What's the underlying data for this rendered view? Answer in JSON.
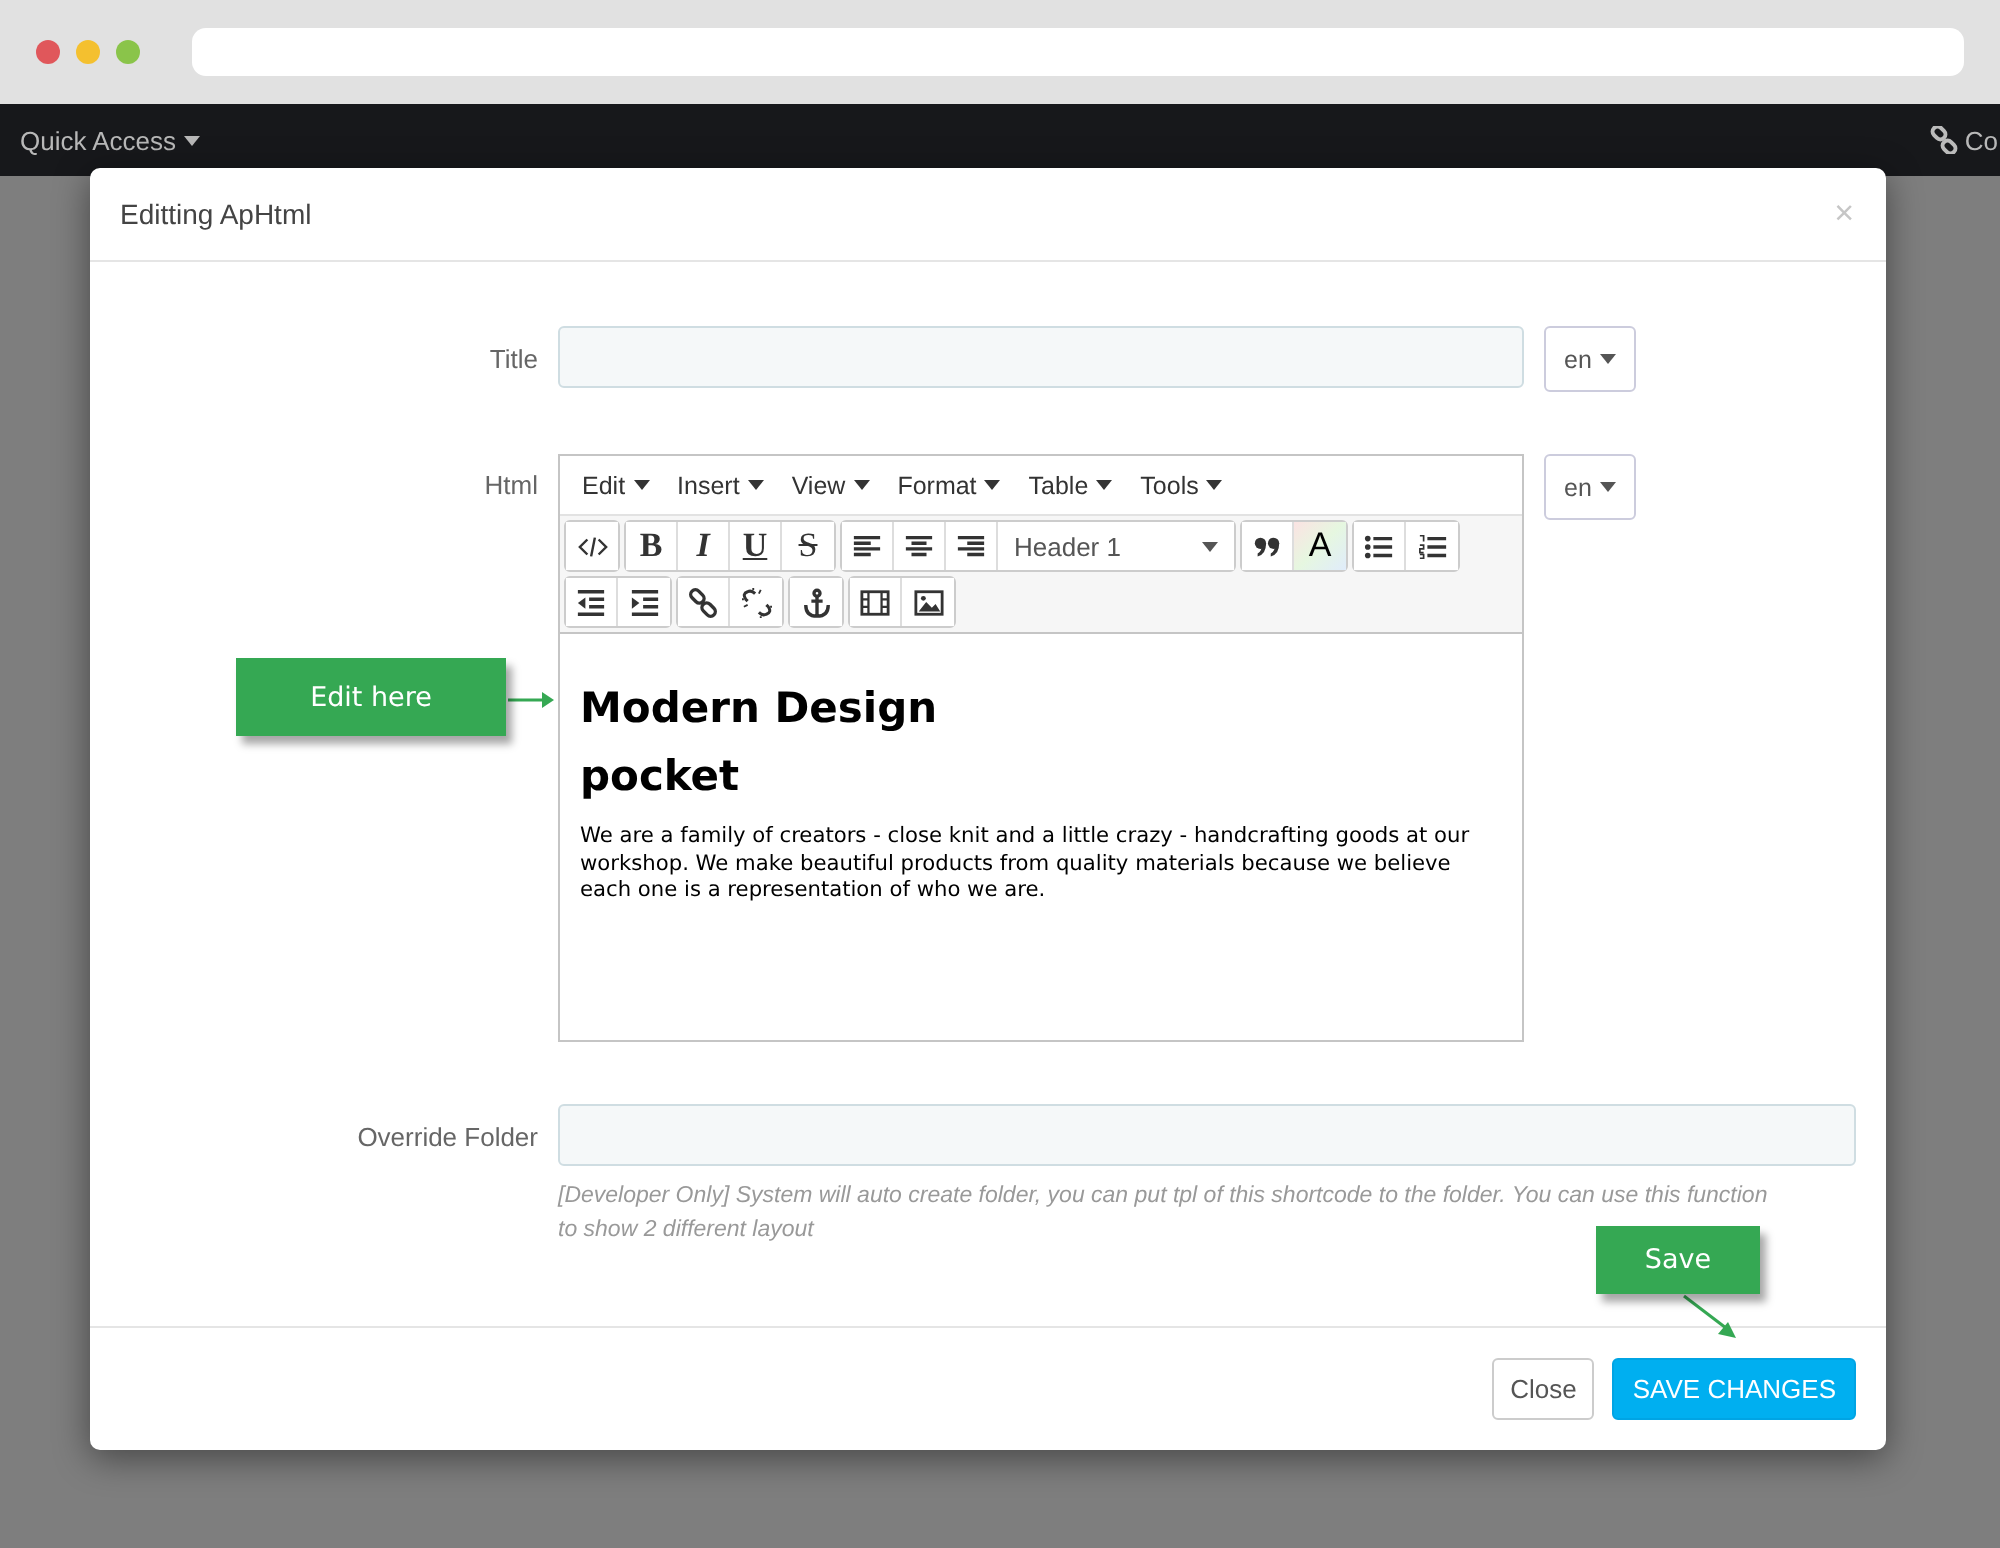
{
  "top_bar": {
    "quick_access": "Quick Access",
    "right_link": "Co"
  },
  "modal": {
    "title": "Editting ApHtml",
    "close": "×",
    "fields": [
      {
        "kind": "text",
        "label": "Title",
        "language": "en"
      },
      {
        "kind": "editor",
        "label": "Html",
        "language": "en"
      },
      {
        "kind": "text",
        "label": "Override Folder",
        "help": "[Developer Only] System will auto create folder, you can put tpl of this shortcode to the folder. You can use this function to show 2 different layout"
      }
    ],
    "editor": {
      "menus": [
        "Edit",
        "Insert",
        "View",
        "Format",
        "Table",
        "Tools"
      ],
      "format_buttons": [
        "B",
        "I",
        "U",
        "S"
      ],
      "block_format": "Header 1",
      "text_color_button": "A",
      "content": [
        {
          "kind": "heading",
          "text": "Modern Design"
        },
        {
          "kind": "heading",
          "text": "pocket"
        },
        {
          "kind": "paragraph",
          "text": "We are a family of creators - close knit and a little crazy - handcrafting goods at our workshop. We make beautiful products from quality materials because we believe each one is a representation of who we are."
        }
      ]
    },
    "buttons": [
      {
        "kind": "secondary",
        "label": "Close"
      },
      {
        "kind": "primary",
        "label": "SAVE CHANGES"
      }
    ]
  },
  "callouts": [
    {
      "kind": "editor",
      "text": "Edit here"
    },
    {
      "kind": "save",
      "text": "Save"
    }
  ]
}
